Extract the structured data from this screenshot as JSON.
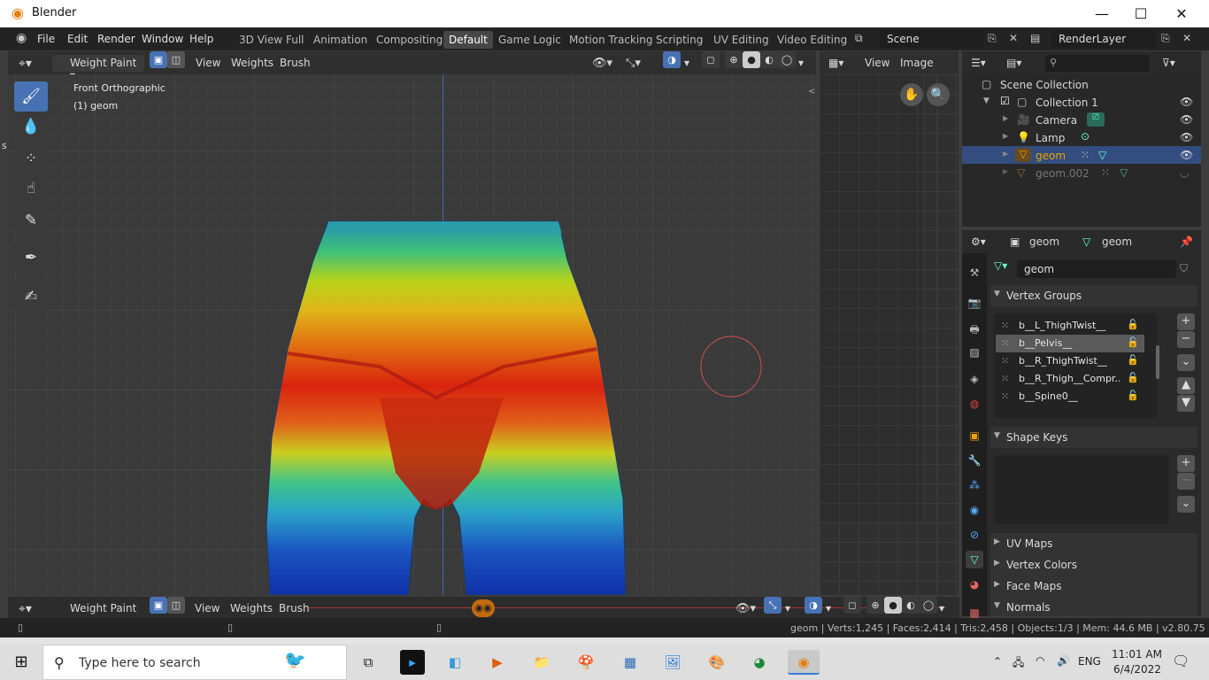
{
  "window": {
    "title": "Blender",
    "minimize": "—",
    "maximize": "☐",
    "close": "✕"
  },
  "menu": {
    "items": [
      "File",
      "Edit",
      "Render",
      "Window",
      "Help"
    ],
    "workspaces": [
      "3D View Full",
      "Animation",
      "Compositing",
      "Default",
      "Game Logic",
      "Motion Tracking",
      "Scripting",
      "UV Editing",
      "Video Editing"
    ],
    "active_workspace": "Default",
    "scene": "Scene",
    "render_layer": "RenderLayer"
  },
  "viewport": {
    "mode": "Weight Paint",
    "menus": [
      "View",
      "Weights",
      "Brush"
    ],
    "view_name": "Front Orthographic",
    "object_label": "(1) geom"
  },
  "bottom_header": {
    "mode": "Weight Paint",
    "menus": [
      "View",
      "Weights",
      "Brush"
    ]
  },
  "image_editor": {
    "menus": [
      "View",
      "Image"
    ]
  },
  "outliner": {
    "search_placeholder": "",
    "scene_collection": "Scene Collection",
    "collection": "Collection 1",
    "objects": [
      "Camera",
      "Lamp",
      "geom",
      "geom.002"
    ],
    "active_object": "geom"
  },
  "properties": {
    "breadcrumb_object": "geom",
    "breadcrumb_data": "geom",
    "mesh_name": "geom",
    "panels": {
      "vertex_groups": "Vertex Groups",
      "shape_keys": "Shape Keys",
      "uv_maps": "UV Maps",
      "vertex_colors": "Vertex Colors",
      "face_maps": "Face Maps",
      "normals": "Normals"
    },
    "vertex_groups": [
      "b__L_ThighTwist__",
      "b__Pelvis__",
      "b__R_ThighTwist__",
      "b__R_Thigh__Compr..",
      "b__Spine0__"
    ],
    "active_vertex_group": "b__Pelvis__"
  },
  "status": {
    "text": "geom | Verts:1,245 | Faces:2,414 | Tris:2,458 | Objects:1/3 | Mem: 44.6 MB | v2.80.75"
  },
  "taskbar": {
    "search_placeholder": "Type here to search",
    "language": "ENG",
    "time": "11:01 AM",
    "date": "6/4/2022"
  },
  "colors": {
    "accent": "#4772b3",
    "active_orange": "#f0a000",
    "selection": "#334d80"
  }
}
